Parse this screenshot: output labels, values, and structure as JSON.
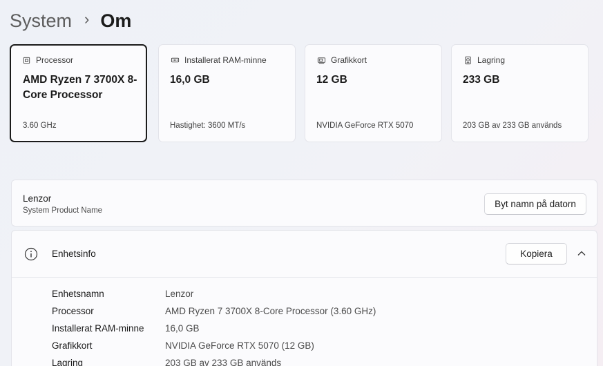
{
  "breadcrumb": {
    "parent": "System",
    "separator": "›",
    "current": "Om"
  },
  "cards": [
    {
      "icon": "processor-icon",
      "label": "Processor",
      "value": "AMD Ryzen 7 3700X 8-Core Processor",
      "sub": "3.60 GHz",
      "selected": true
    },
    {
      "icon": "ram-icon",
      "label": "Installerat RAM-minne",
      "value": "16,0 GB",
      "sub": "Hastighet: 3600 MT/s"
    },
    {
      "icon": "gpu-icon",
      "label": "Grafikkort",
      "value": "12 GB",
      "sub": "NVIDIA GeForce RTX 5070"
    },
    {
      "icon": "storage-icon",
      "label": "Lagring",
      "value": "233 GB",
      "sub": "203 GB av 233 GB används"
    }
  ],
  "device": {
    "name": "Lenzor",
    "subtitle": "System Product Name",
    "rename_label": "Byt namn på datorn"
  },
  "device_info": {
    "title": "Enhetsinfo",
    "copy_label": "Kopiera",
    "rows": [
      {
        "label": "Enhetsnamn",
        "value": "Lenzor"
      },
      {
        "label": "Processor",
        "value": "AMD Ryzen 7 3700X 8-Core Processor (3.60 GHz)"
      },
      {
        "label": "Installerat RAM-minne",
        "value": "16,0 GB"
      },
      {
        "label": "Grafikkort",
        "value": "NVIDIA GeForce RTX 5070 (12 GB)"
      },
      {
        "label": "Lagring",
        "value": "203 GB av 233 GB används"
      }
    ]
  }
}
